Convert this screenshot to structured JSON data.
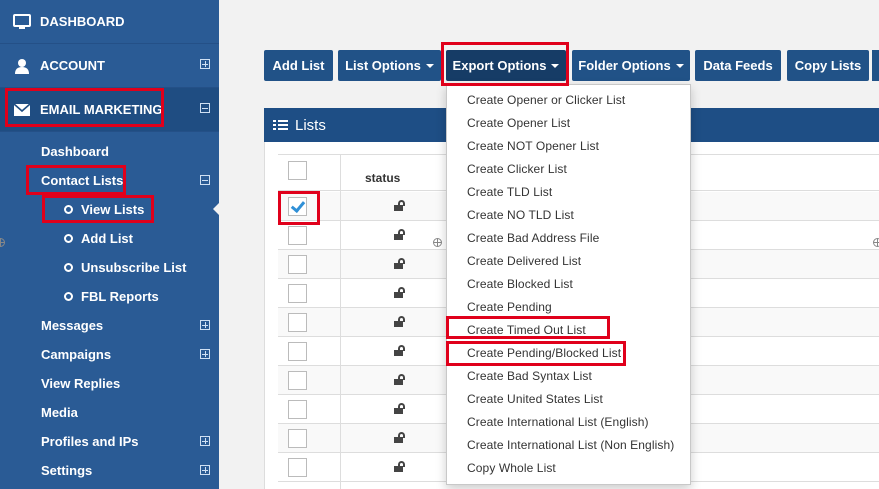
{
  "sidebar": {
    "top_items": [
      {
        "label": "DASHBOARD",
        "icon": "monitor-icon"
      },
      {
        "label": "ACCOUNT",
        "icon": "user-icon"
      },
      {
        "label": "EMAIL MARKETING",
        "icon": "envelope-icon"
      }
    ],
    "email_marketing": {
      "dashboard": "Dashboard",
      "contact_lists": "Contact Lists",
      "contact_lists_children": [
        "View Lists",
        "Add List",
        "Unsubscribe List",
        "FBL Reports"
      ],
      "messages": "Messages",
      "campaigns": "Campaigns",
      "view_replies": "View Replies",
      "media": "Media",
      "profiles_ips": "Profiles and IPs",
      "settings": "Settings"
    }
  },
  "toolbar": {
    "add_list": "Add List",
    "list_options": "List Options",
    "export_options": "Export Options",
    "folder_options": "Folder Options",
    "data_feeds": "Data Feeds",
    "copy_lists": "Copy Lists"
  },
  "panel": {
    "title": "Lists",
    "status_header": "status"
  },
  "export_menu": [
    "Create Opener or Clicker List",
    "Create Opener List",
    "Create NOT Opener List",
    "Create Clicker List",
    "Create TLD List",
    "Create NO TLD List",
    "Create Bad Address File",
    "Create Delivered List",
    "Create Blocked List",
    "Create Pending",
    "Create Timed Out List",
    "Create Pending/Blocked List",
    "Create Bad Syntax List",
    "Create United States List",
    "Create International List (English)",
    "Create International List (Non English)",
    "Copy Whole List"
  ],
  "colors": {
    "sidebar": "#2a5b95",
    "button": "#215287",
    "highlight": "#e0001b",
    "checkmark": "#2f8fd6"
  }
}
